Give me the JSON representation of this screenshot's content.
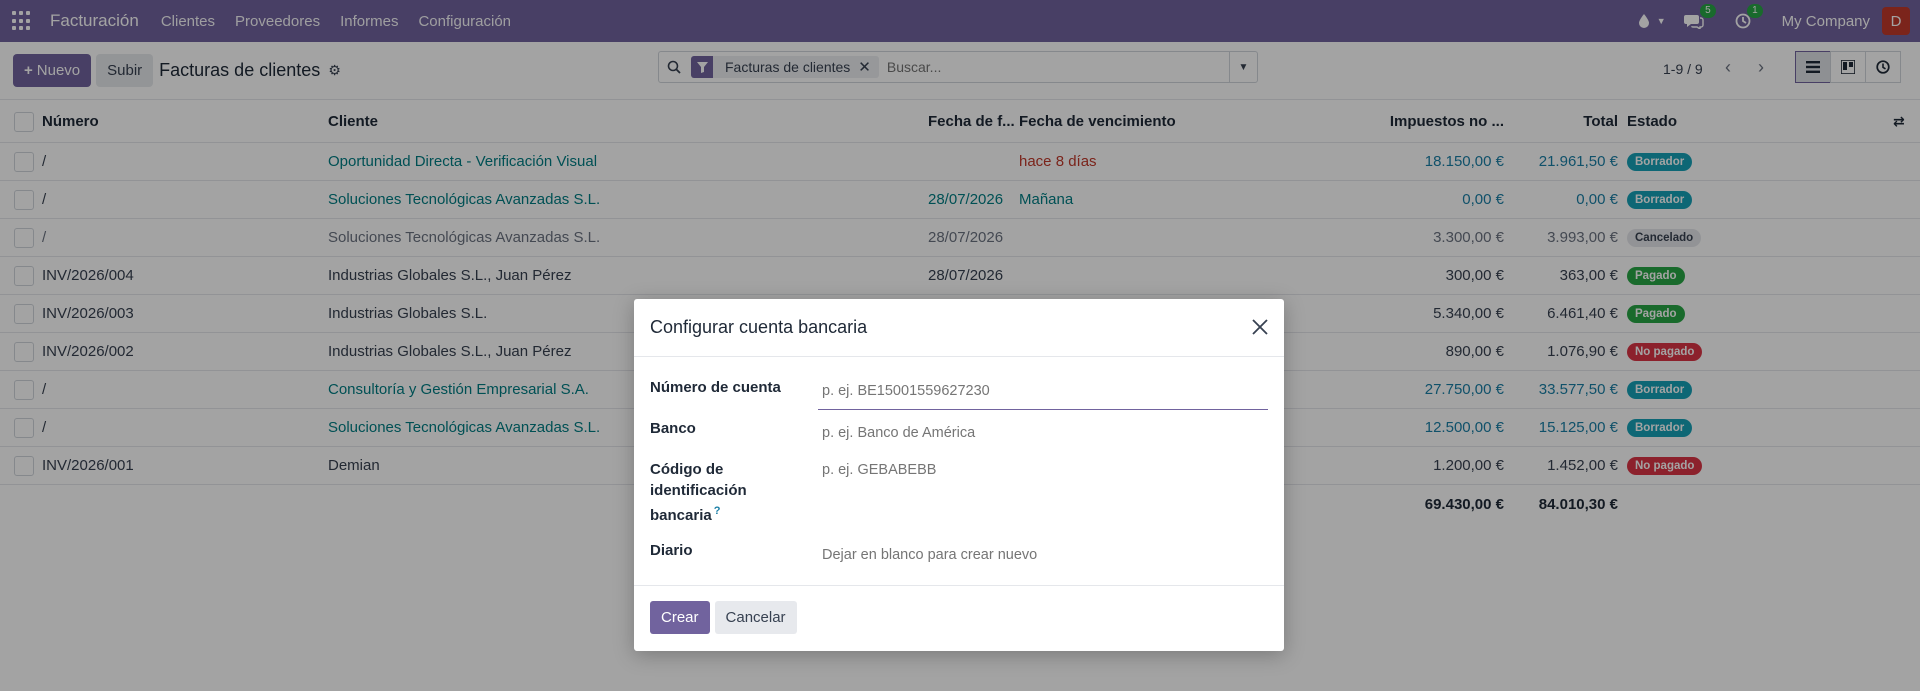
{
  "navbar": {
    "brand": "Facturación",
    "menu": [
      "Clientes",
      "Proveedores",
      "Informes",
      "Configuración"
    ],
    "messages_count": "5",
    "activity_count": "1",
    "company": "My Company",
    "avatar_letter": "D"
  },
  "control": {
    "new_label": "Nuevo",
    "upload_label": "Subir",
    "title": "Facturas de clientes",
    "facet": "Facturas de clientes",
    "search_placeholder": "Buscar...",
    "pager": "1-9 / 9"
  },
  "table": {
    "headers": {
      "number": "Número",
      "client": "Cliente",
      "invoice_date": "Fecha de f...",
      "due_date": "Fecha de vencimiento",
      "taxes": "Impuestos no ...",
      "total": "Total",
      "status": "Estado"
    },
    "rows": [
      {
        "number": "/",
        "client": "Oportunidad Directa - Verificación Visual",
        "invoice_date": "",
        "due_date": "hace 8 días",
        "taxes": "18.150,00 €",
        "total": "21.961,50 €",
        "status": "Borrador"
      },
      {
        "number": "/",
        "client": "Soluciones Tecnológicas Avanzadas S.L.",
        "invoice_date": "28/07/2026",
        "due_date": "Mañana",
        "taxes": "0,00 €",
        "total": "0,00 €",
        "status": "Borrador"
      },
      {
        "number": "/",
        "client": "Soluciones Tecnológicas Avanzadas S.L.",
        "invoice_date": "28/07/2026",
        "due_date": "",
        "taxes": "3.300,00 €",
        "total": "3.993,00 €",
        "status": "Cancelado"
      },
      {
        "number": "INV/2026/004",
        "client": "Industrias Globales S.L., Juan Pérez",
        "invoice_date": "28/07/2026",
        "due_date": "",
        "taxes": "300,00 €",
        "total": "363,00 €",
        "status": "Pagado"
      },
      {
        "number": "INV/2026/003",
        "client": "Industrias Globales S.L.",
        "invoice_date": "",
        "due_date": "",
        "taxes": "5.340,00 €",
        "total": "6.461,40 €",
        "status": "Pagado"
      },
      {
        "number": "INV/2026/002",
        "client": "Industrias Globales S.L., Juan Pérez",
        "invoice_date": "",
        "due_date": "",
        "taxes": "890,00 €",
        "total": "1.076,90 €",
        "status": "No pagado"
      },
      {
        "number": "/",
        "client": "Consultoría y Gestión Empresarial S.A.",
        "invoice_date": "",
        "due_date": "",
        "taxes": "27.750,00 €",
        "total": "33.577,50 €",
        "status": "Borrador"
      },
      {
        "number": "/",
        "client": "Soluciones Tecnológicas Avanzadas S.L.",
        "invoice_date": "",
        "due_date": "",
        "taxes": "12.500,00 €",
        "total": "15.125,00 €",
        "status": "Borrador"
      },
      {
        "number": "INV/2026/001",
        "client": "Demian",
        "invoice_date": "",
        "due_date": "",
        "taxes": "1.200,00 €",
        "total": "1.452,00 €",
        "status": "No pagado"
      }
    ],
    "totals": {
      "taxes": "69.430,00 €",
      "total": "84.010,30 €"
    }
  },
  "modal": {
    "title": "Configurar cuenta bancaria",
    "fields": {
      "account_label": "Número de cuenta",
      "account_placeholder": "p. ej. BE15001559627230",
      "bank_label": "Banco",
      "bank_placeholder": "p. ej. Banco de América",
      "bic_label": "Código de identificación bancaria",
      "bic_help": "?",
      "bic_placeholder": "p. ej. GEBABEBB",
      "journal_label": "Diario",
      "journal_placeholder": "Dejar en blanco para crear nuevo"
    },
    "create_label": "Crear",
    "cancel_label": "Cancelar"
  },
  "colors": {
    "brand": "#71639e",
    "draft": "#17a2b8",
    "paid": "#28a745",
    "not_paid": "#dc3545"
  }
}
